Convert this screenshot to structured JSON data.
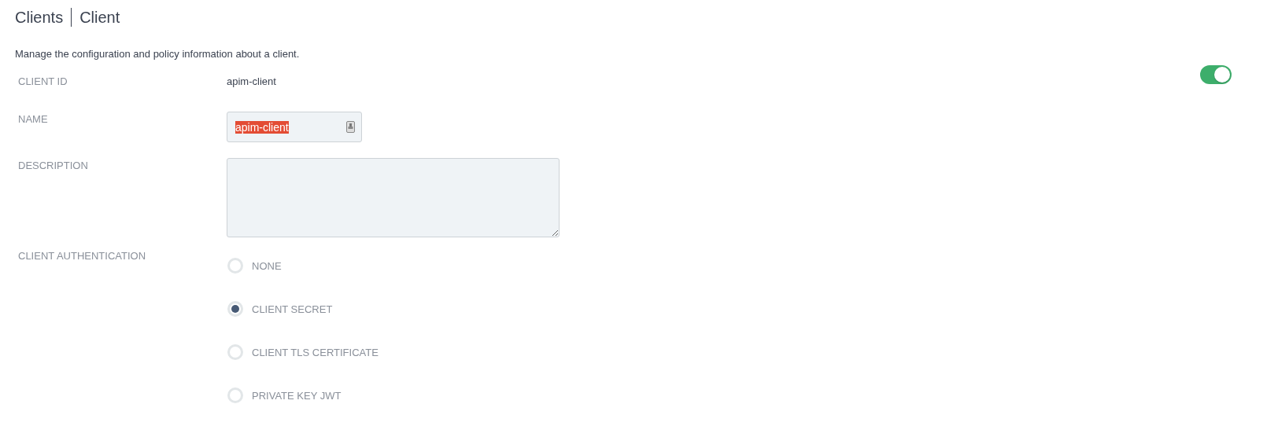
{
  "breadcrumb": {
    "section": "Clients",
    "page": "Client"
  },
  "intro": "Manage the configuration and policy information about a client.",
  "enabled_toggle": {
    "on": true
  },
  "fields": [
    {
      "kind": "text",
      "label": "CLIENT ID",
      "value": "apim-client"
    },
    {
      "kind": "input",
      "label": "NAME",
      "value": "apim-client",
      "text_selected": true
    },
    {
      "kind": "textarea",
      "label": "DESCRIPTION"
    },
    {
      "kind": "radio",
      "label": "CLIENT AUTHENTICATION",
      "options": [
        {
          "label": "NONE",
          "selected": false
        },
        {
          "label": "CLIENT SECRET",
          "selected": true
        },
        {
          "label": "CLIENT TLS CERTIFICATE",
          "selected": false
        },
        {
          "label": "PRIVATE KEY JWT",
          "selected": false
        }
      ]
    }
  ]
}
